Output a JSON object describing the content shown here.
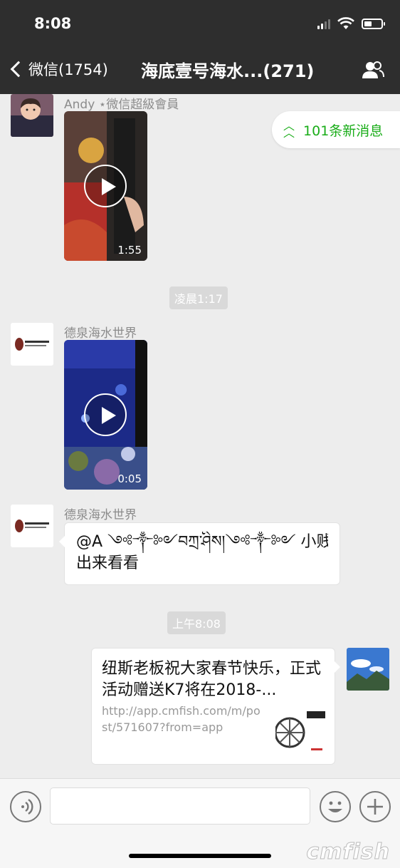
{
  "status_bar": {
    "time": "8:08"
  },
  "nav": {
    "back_label": "微信(1754)",
    "title": "海底壹号海水...(271)"
  },
  "new_messages": {
    "label": "101条新消息"
  },
  "messages": [
    {
      "sender": "Andy ⋆微信超級會員",
      "type": "video",
      "duration": "1:55"
    },
    {
      "type": "time",
      "text": "凌晨1:17"
    },
    {
      "sender": "德泉海水世界",
      "type": "video",
      "duration": "0:05"
    },
    {
      "sender": "德泉海水世界",
      "type": "text",
      "text_line1": "@A ༺༒༻བཀྲ་ཤིས།༺༒༻ 小贱人",
      "text_line2": "出来看看"
    },
    {
      "type": "time",
      "text": "上午8:08"
    },
    {
      "type": "link",
      "title": "纽斯老板祝大家春节快乐，正式活动赠送K7将在2018-...",
      "url": "http://app.cmfish.com/m/post/571607?from=app"
    }
  ],
  "watermark": "cmfish",
  "colors": {
    "nav_bg": "#2e2e2e",
    "chat_bg": "#ededed",
    "accent_green": "#1aad19"
  }
}
